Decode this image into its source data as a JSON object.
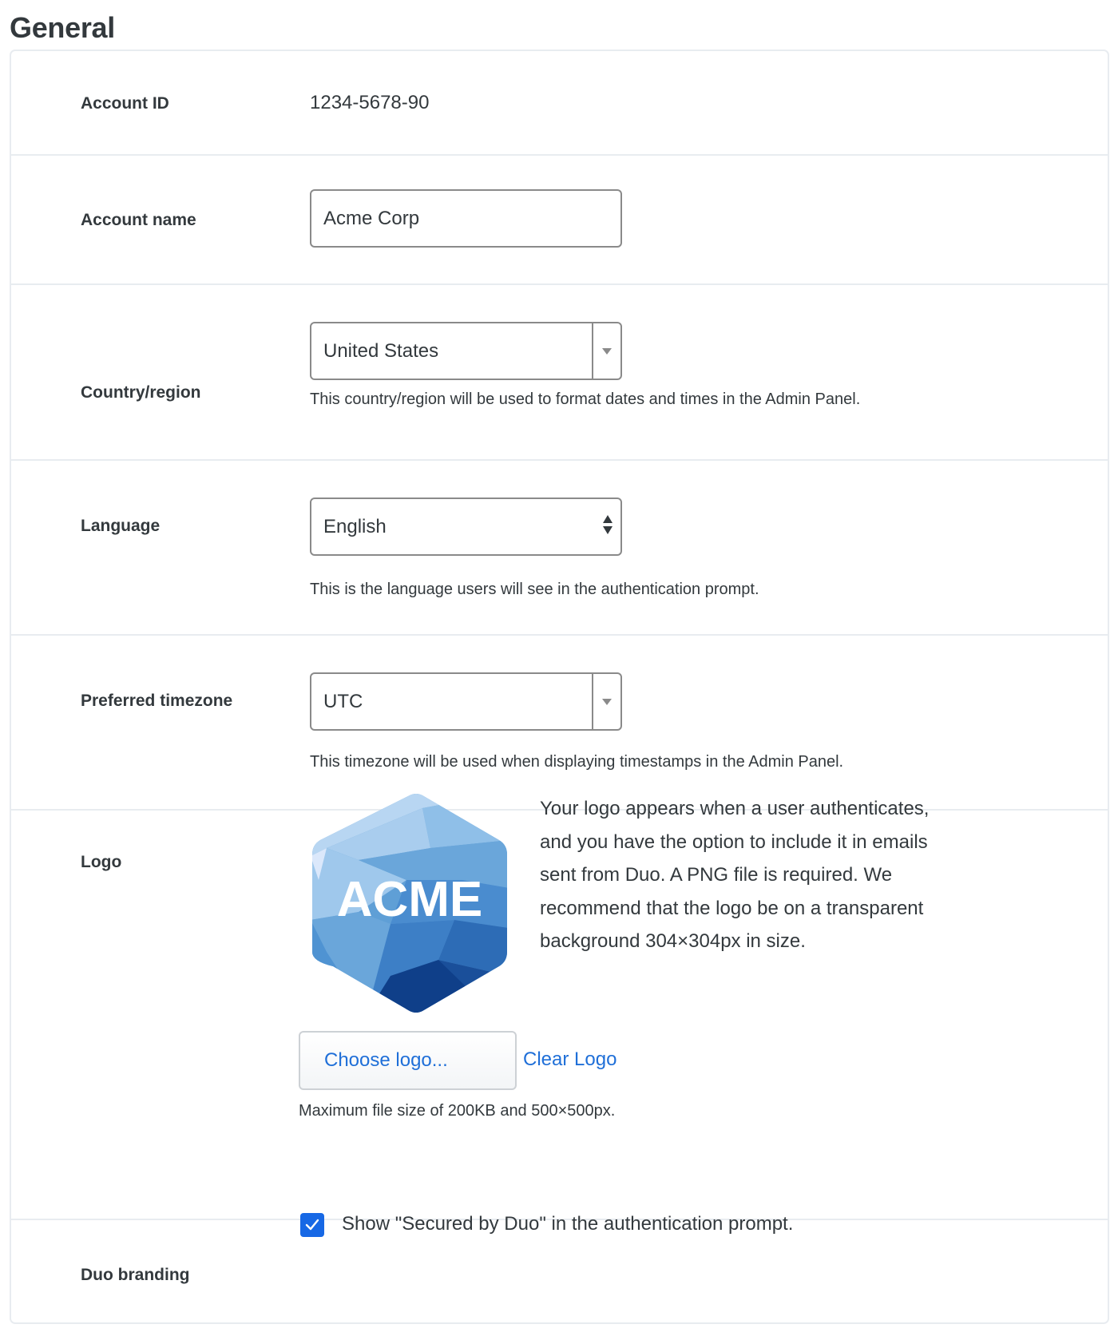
{
  "page": {
    "title": "General"
  },
  "fields": {
    "account_id": {
      "label": "Account ID",
      "value": "1234-5678-90"
    },
    "account_name": {
      "label": "Account name",
      "value": "Acme Corp"
    },
    "country_region": {
      "label": "Country/region",
      "selected": "United States",
      "help": "This country/region will be used to format dates and times in the Admin Panel.",
      "icon": "chevron-down-icon"
    },
    "language": {
      "label": "Language",
      "selected": "English",
      "help": "This is the language users will see in the authentication prompt.",
      "icon": "up-down-arrows-icon"
    },
    "timezone": {
      "label": "Preferred timezone",
      "selected": "UTC",
      "help": "This timezone will be used when displaying timestamps in the Admin Panel.",
      "icon": "chevron-down-icon"
    },
    "logo": {
      "label": "Logo",
      "logo_text": "ACME",
      "description": "Your logo appears when a user authenticates, and you have the option to include it in emails sent from Duo. A PNG file is required. We recommend that the logo be on a transparent background 304×304px in size.",
      "choose_button": "Choose logo...",
      "clear_link": "Clear Logo",
      "help": "Maximum file size of 200KB and 500×500px."
    },
    "duo_branding": {
      "label": "Duo branding",
      "checkbox_label": "Show \"Secured by Duo\" in the authentication prompt.",
      "checked": true
    }
  },
  "colors": {
    "accent": "#1768e5",
    "link": "#1f6fd8",
    "text": "#33393d",
    "border": "#e8ecf0"
  }
}
